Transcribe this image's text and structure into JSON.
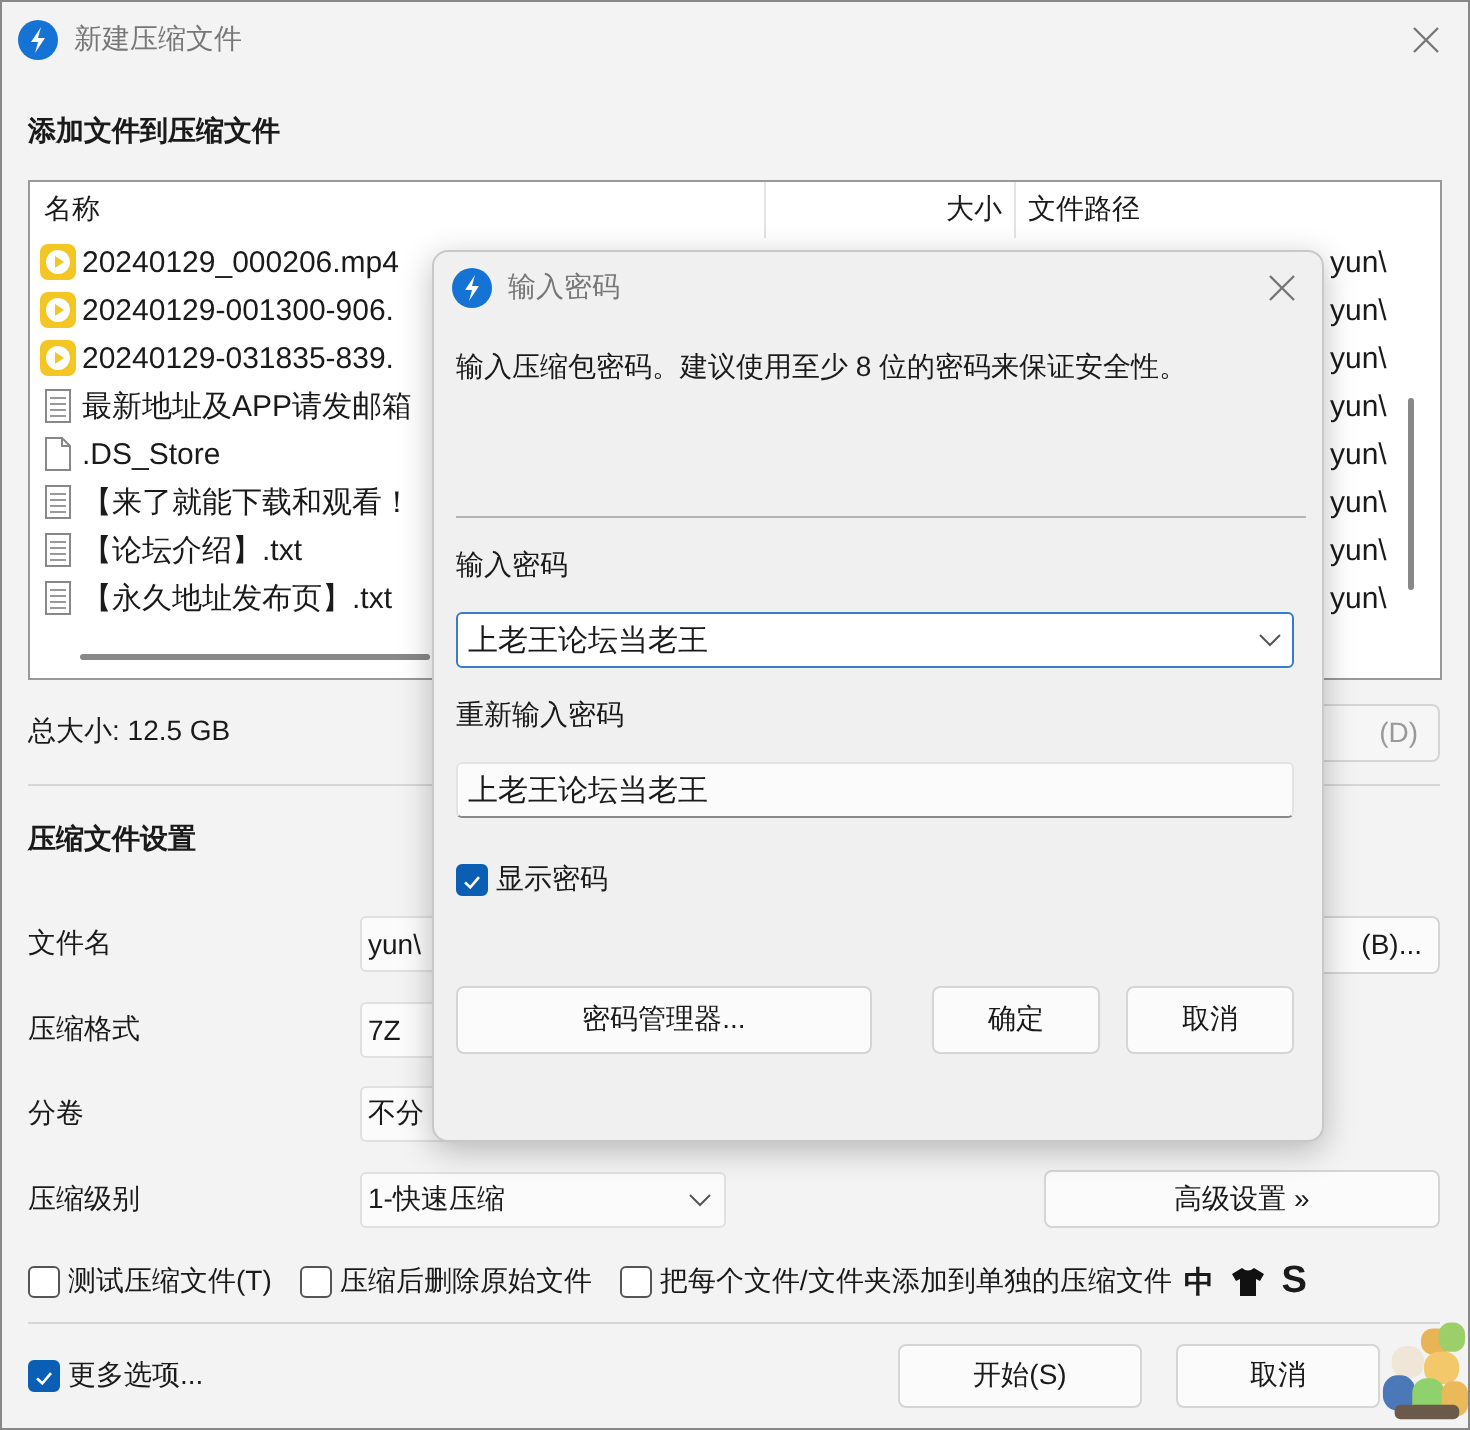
{
  "window": {
    "title": "新建压缩文件"
  },
  "files_section": {
    "heading": "添加文件到压缩文件",
    "columns": [
      "名称",
      "大小",
      "文件路径"
    ],
    "rows": [
      {
        "name": "20240129_000206.mp4",
        "kind": "video",
        "path": "yun\\"
      },
      {
        "name": "20240129-001300-906.",
        "kind": "video",
        "path": "yun\\"
      },
      {
        "name": "20240129-031835-839.",
        "kind": "video",
        "path": "yun\\"
      },
      {
        "name": "最新地址及APP请发邮箱",
        "kind": "text",
        "path": "yun\\"
      },
      {
        "name": ".DS_Store",
        "kind": "blank",
        "path": "yun\\"
      },
      {
        "name": "【来了就能下载和观看！",
        "kind": "text",
        "path": "yun\\"
      },
      {
        "name": "【论坛介绍】.txt",
        "kind": "text",
        "path": "yun\\"
      },
      {
        "name": "【永久地址发布页】.txt",
        "kind": "text",
        "path": "yun\\"
      }
    ]
  },
  "total_size": "总大小: 12.5 GB",
  "delete_button": "(D)",
  "settings": {
    "heading": "压缩文件设置",
    "fields": [
      {
        "label": "文件名",
        "value": "yun\\",
        "kind": "text"
      },
      {
        "label": "压缩格式",
        "value": "7Z",
        "kind": "text"
      },
      {
        "label": "分卷",
        "value": "不分",
        "kind": "text"
      },
      {
        "label": "压缩级别",
        "value": "1-快速压缩",
        "kind": "select"
      }
    ],
    "browse_button": "(B)...",
    "advanced_button": "高级设置 »"
  },
  "options": [
    {
      "label": "测试压缩文件(T)",
      "checked": false
    },
    {
      "label": "压缩后删除原始文件",
      "checked": false
    },
    {
      "label": "把每个文件/文件夹添加到单独的压缩文件",
      "checked": false
    }
  ],
  "ime_toolbar": [
    "中",
    "S"
  ],
  "more_options": {
    "label": "更多选项...",
    "checked": true
  },
  "buttons": [
    "开始(S)",
    "取消"
  ],
  "dialog": {
    "title": "输入密码",
    "description": "输入压缩包密码。建议使用至少 8 位的密码来保证安全性。",
    "password_label": "输入密码",
    "password": "上老王论坛当老王",
    "confirm_label": "重新输入密码",
    "confirm_value": "上老王论坛当老王",
    "show_password": {
      "label": "显示密码",
      "checked": true
    },
    "manager_button": "密码管理器...",
    "ok_button": "确定",
    "cancel_button": "取消"
  }
}
